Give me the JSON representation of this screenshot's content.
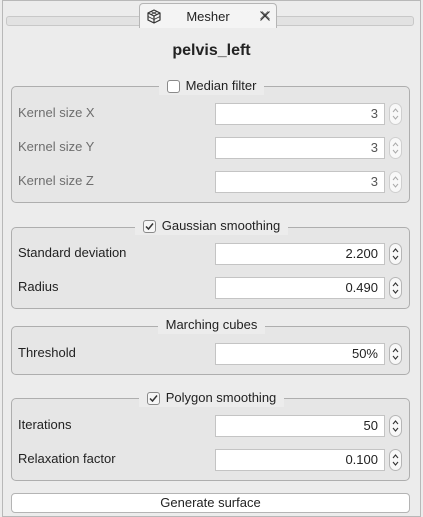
{
  "tab": {
    "label": "Mesher",
    "icon": "mesh-cube-icon",
    "close_icon": "close-icon"
  },
  "title": "pelvis_left",
  "median_filter": {
    "label": "Median filter",
    "checked": false,
    "rows": [
      {
        "label": "Kernel size X",
        "value": "3"
      },
      {
        "label": "Kernel size Y",
        "value": "3"
      },
      {
        "label": "Kernel size Z",
        "value": "3"
      }
    ]
  },
  "gaussian_smoothing": {
    "label": "Gaussian smoothing",
    "checked": true,
    "rows": [
      {
        "label": "Standard deviation",
        "value": "2.200"
      },
      {
        "label": "Radius",
        "value": "0.490"
      }
    ]
  },
  "marching_cubes": {
    "label": "Marching cubes",
    "rows": [
      {
        "label": "Threshold",
        "value": "50%"
      }
    ]
  },
  "polygon_smoothing": {
    "label": "Polygon smoothing",
    "checked": true,
    "rows": [
      {
        "label": "Iterations",
        "value": "50"
      },
      {
        "label": "Relaxation factor",
        "value": "0.100"
      }
    ]
  },
  "generate_button": {
    "label": "Generate surface"
  }
}
